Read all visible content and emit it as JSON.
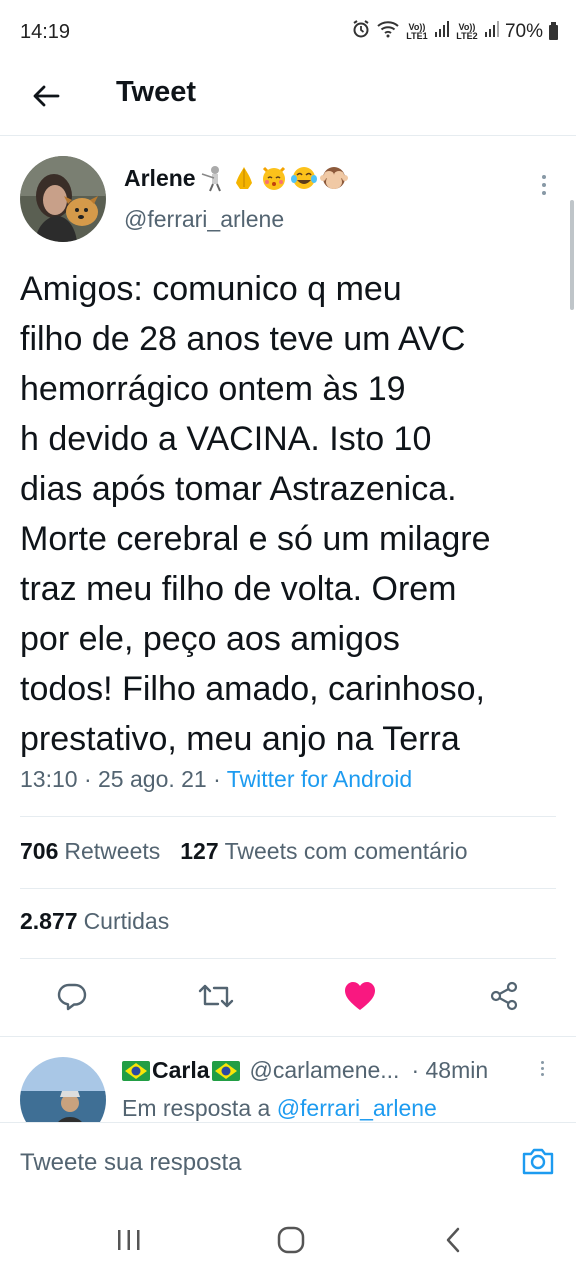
{
  "status_bar": {
    "time": "14:19",
    "sim1": "Vo)) LTE1",
    "sim2": "Vo)) LTE2",
    "battery": "70%",
    "icons": [
      "alarm-icon",
      "wifi-icon",
      "signal-icon",
      "battery-icon"
    ]
  },
  "header": {
    "title": "Tweet",
    "back_icon": "arrow-left-icon"
  },
  "tweet": {
    "author_name": "Arlene",
    "author_emojis": [
      "fencer-emoji",
      "folded-hands-emoji",
      "kissing-cat-emoji",
      "tears-of-joy-emoji",
      "see-no-evil-monkey-emoji"
    ],
    "author_handle": "@ferrari_arlene",
    "text": "Amigos: comunico q meu\nfilho de 28 anos teve um AVC\nhemorrágico ontem às 19\nh devido a VACINA. Isto 10\ndias após tomar Astrazenica.\nMorte cerebral e só um milagre\ntraz meu filho de volta. Orem\npor ele, peço aos amigos\ntodos! Filho amado, carinhoso,\nprestativo, meu anjo na Terra",
    "time": "13:10",
    "date": "25 ago. 21",
    "sep": "·",
    "source": "Twitter for Android",
    "retweets_count": "706",
    "retweets_label": "Retweets",
    "quotes_count": "127",
    "quotes_label": "Tweets com comentário",
    "likes_count": "2.877",
    "likes_label": "Curtidas"
  },
  "actions": {
    "reply_icon": "reply-icon",
    "retweet_icon": "retweet-icon",
    "like_icon": "heart-filled-icon",
    "share_icon": "share-icon",
    "like_color": "#f91880",
    "icon_color": "#536471"
  },
  "reply": {
    "name": "Carla",
    "handle": "@carlamene...",
    "time": "· 48min",
    "replying_prefix": "Em resposta a",
    "replying_mention": "@ferrari_arlene"
  },
  "compose": {
    "placeholder": "Tweete sua resposta",
    "camera_icon": "camera-icon"
  },
  "nav": {
    "recent_icon": "recent-apps-icon",
    "home_icon": "home-icon",
    "back_icon": "nav-back-icon"
  },
  "colors": {
    "accent": "#1d9bf0",
    "secondary_text": "#536471",
    "primary_text": "#0f1419"
  }
}
